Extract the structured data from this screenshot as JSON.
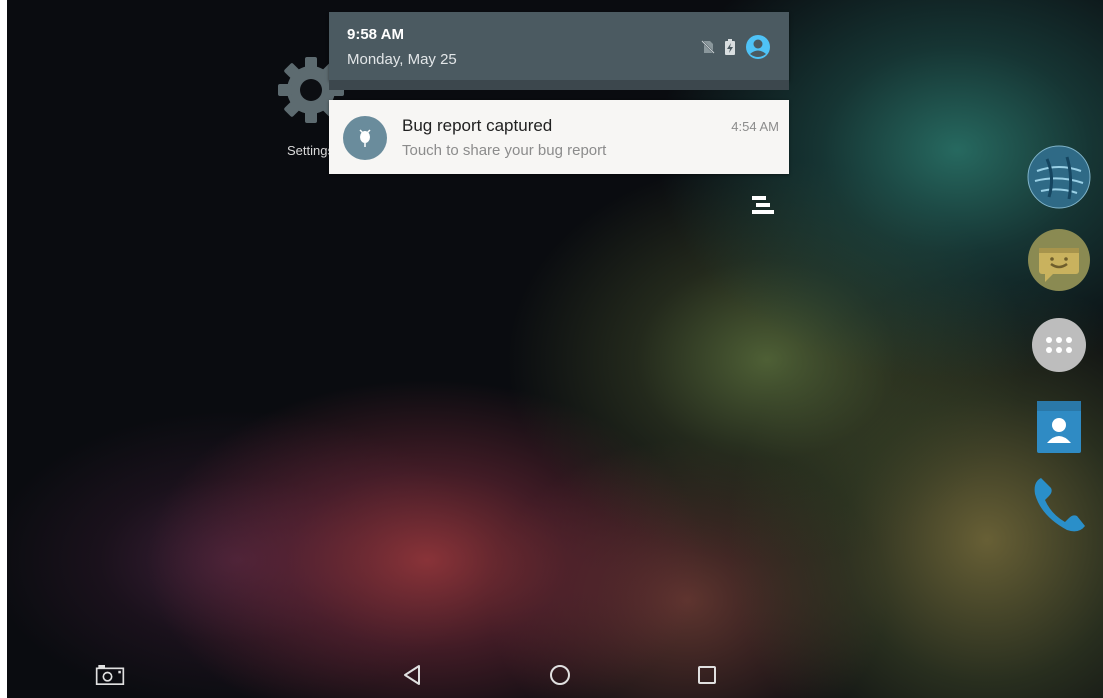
{
  "status": {
    "time": "9:58 AM",
    "date": "Monday, May 25",
    "icons": [
      "no-sim-icon",
      "battery-charging-icon",
      "user-avatar-icon"
    ]
  },
  "desktop": {
    "settings_label": "Settings"
  },
  "notification": {
    "title": "Bug report captured",
    "text": "Touch to share your bug report",
    "time": "4:54 AM",
    "icon": "bug-icon",
    "icon_bg": "#6a8c9c"
  },
  "dock": [
    "browser-globe-icon",
    "messaging-icon",
    "all-apps-icon",
    "contacts-icon",
    "phone-icon"
  ],
  "navbar": [
    "screenshot-icon",
    "back-icon",
    "home-icon",
    "recents-icon"
  ],
  "colors": {
    "shade_header": "#4b5a61",
    "accent": "#4fc3f7"
  }
}
